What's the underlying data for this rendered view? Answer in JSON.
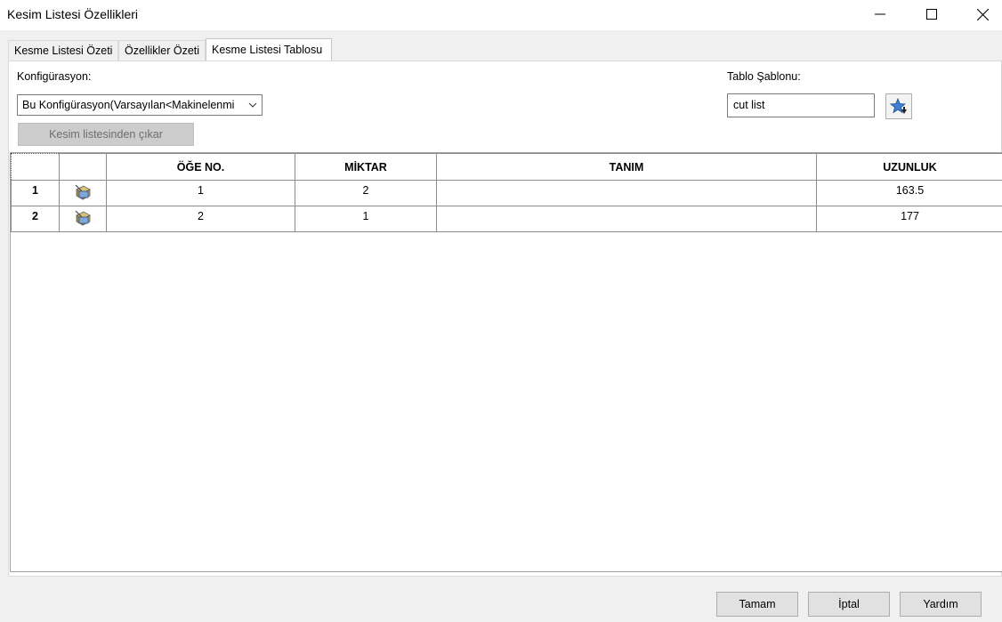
{
  "window": {
    "title": "Kesim Listesi Özellikleri",
    "minimize_icon": "minimize-icon",
    "maximize_icon": "maximize-icon",
    "close_icon": "close-icon"
  },
  "tabs": [
    {
      "label": "Kesme Listesi Özeti",
      "active": false
    },
    {
      "label": "Özellikler Özeti",
      "active": false
    },
    {
      "label": "Kesme Listesi Tablosu",
      "active": true
    }
  ],
  "configuration": {
    "label": "Konfigürasyon:",
    "selected": "Bu Konfigürasyon(Varsayılan<Makinelenmi"
  },
  "exclude_button": {
    "label": "Kesim listesinden çıkar",
    "enabled": false
  },
  "table_template": {
    "label": "Tablo Şablonu:",
    "value": "cut list",
    "browse_icon": "star-download-icon"
  },
  "table": {
    "columns": [
      "ÖĞE NO.",
      "MİKTAR",
      "TANIM",
      "UZUNLUK"
    ],
    "rows": [
      {
        "row_number": "1",
        "icon": "weldment-part-icon",
        "cells": [
          "1",
          "2",
          "",
          "163.5"
        ]
      },
      {
        "row_number": "2",
        "icon": "weldment-part-icon",
        "cells": [
          "2",
          "1",
          "",
          "177"
        ]
      }
    ]
  },
  "footer": {
    "ok": "Tamam",
    "cancel": "İptal",
    "help": "Yardım"
  },
  "colors": {
    "dialog_bg": "#f0f0f0",
    "panel_bg": "#ffffff",
    "grid_line": "#8c8c8c",
    "icon_blue": "#3d7fd0"
  }
}
